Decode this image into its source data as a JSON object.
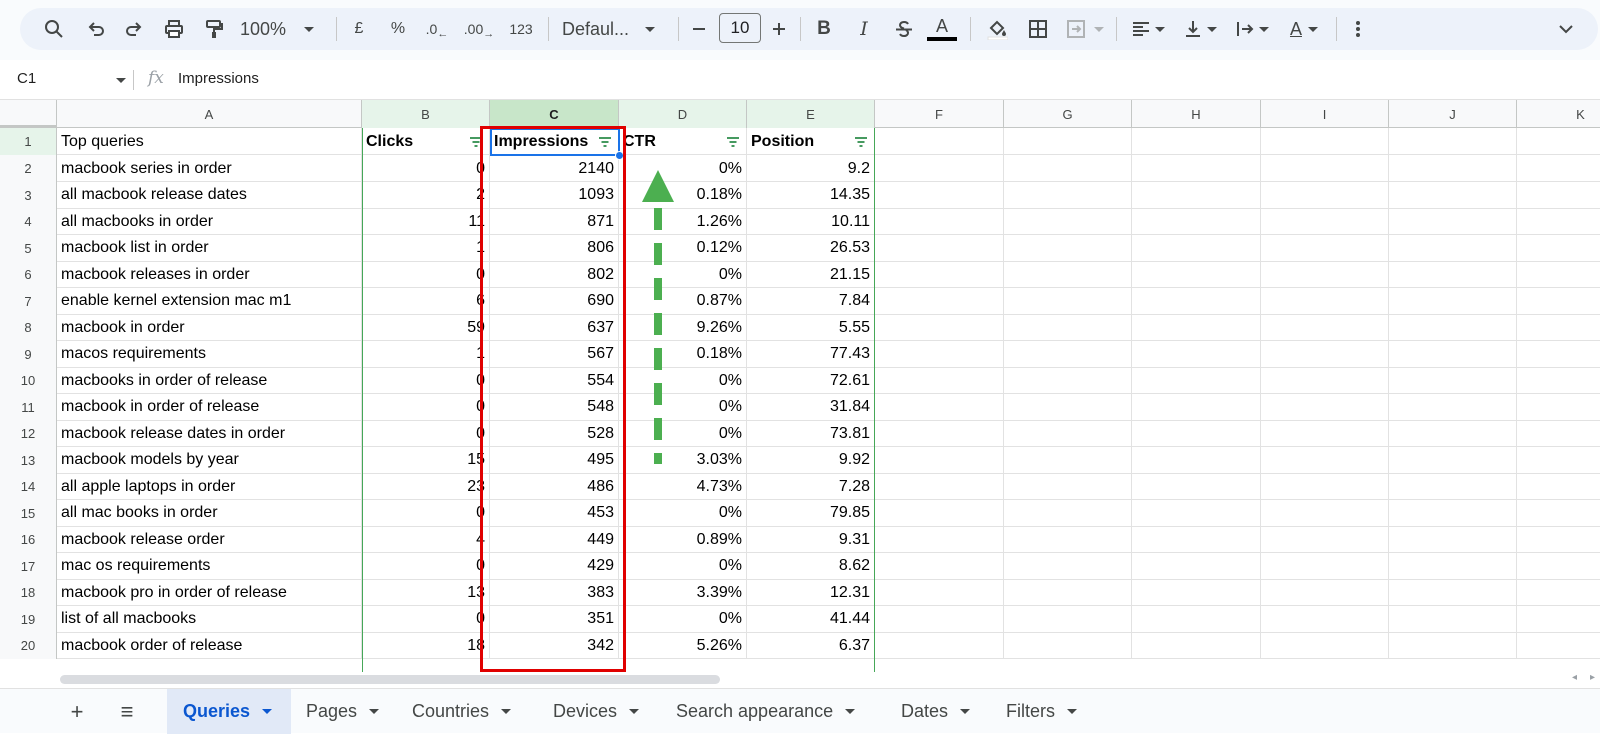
{
  "toolbar": {
    "zoom": "100%",
    "currency": "£",
    "percent": "%",
    "decrease_decimal": ".0",
    "increase_decimal": ".00",
    "number_format": "123",
    "font_name": "Defaul...",
    "font_size": "10",
    "bold": "B",
    "italic": "I",
    "text_color_letter": "A",
    "text_rotate_letter": "A",
    "icons": [
      "search-icon",
      "undo-icon",
      "redo-icon",
      "print-icon",
      "paint-format-icon",
      "minus-icon",
      "plus-icon",
      "strikethrough-icon",
      "fill-color-icon",
      "borders-icon",
      "merge-icon",
      "align-icon",
      "valign-icon",
      "wrap-icon",
      "more-icon",
      "collapse-icon"
    ]
  },
  "formula_bar": {
    "cell_ref": "C1",
    "fx": "fx",
    "content": "Impressions"
  },
  "columns": [
    "A",
    "B",
    "C",
    "D",
    "E",
    "F",
    "G",
    "H",
    "I",
    "J",
    "K"
  ],
  "header_row": {
    "number": "1",
    "query": "Top queries",
    "clicks": "Clicks",
    "impressions": "Impressions",
    "ctr": "CTR",
    "position": "Position"
  },
  "rows": [
    {
      "n": "2",
      "query": "macbook series in order",
      "clicks": "0",
      "impressions": "2140",
      "ctr": "0%",
      "position": "9.2"
    },
    {
      "n": "3",
      "query": "all macbook release dates",
      "clicks": "2",
      "impressions": "1093",
      "ctr": "0.18%",
      "position": "14.35"
    },
    {
      "n": "4",
      "query": "all macbooks in order",
      "clicks": "11",
      "impressions": "871",
      "ctr": "1.26%",
      "position": "10.11"
    },
    {
      "n": "5",
      "query": "macbook list in order",
      "clicks": "1",
      "impressions": "806",
      "ctr": "0.12%",
      "position": "26.53"
    },
    {
      "n": "6",
      "query": "macbook releases in order",
      "clicks": "0",
      "impressions": "802",
      "ctr": "0%",
      "position": "21.15"
    },
    {
      "n": "7",
      "query": "enable kernel extension mac m1",
      "clicks": "6",
      "impressions": "690",
      "ctr": "0.87%",
      "position": "7.84"
    },
    {
      "n": "8",
      "query": "macbook in order",
      "clicks": "59",
      "impressions": "637",
      "ctr": "9.26%",
      "position": "5.55"
    },
    {
      "n": "9",
      "query": "macos requirements",
      "clicks": "1",
      "impressions": "567",
      "ctr": "0.18%",
      "position": "77.43"
    },
    {
      "n": "10",
      "query": "macbooks in order of release",
      "clicks": "0",
      "impressions": "554",
      "ctr": "0%",
      "position": "72.61"
    },
    {
      "n": "11",
      "query": "macbook in order of release",
      "clicks": "0",
      "impressions": "548",
      "ctr": "0%",
      "position": "31.84"
    },
    {
      "n": "12",
      "query": "macbook release dates in order",
      "clicks": "0",
      "impressions": "528",
      "ctr": "0%",
      "position": "73.81"
    },
    {
      "n": "13",
      "query": "macbook models by year",
      "clicks": "15",
      "impressions": "495",
      "ctr": "3.03%",
      "position": "9.92"
    },
    {
      "n": "14",
      "query": "all apple laptops in order",
      "clicks": "23",
      "impressions": "486",
      "ctr": "4.73%",
      "position": "7.28"
    },
    {
      "n": "15",
      "query": "all mac books in order",
      "clicks": "0",
      "impressions": "453",
      "ctr": "0%",
      "position": "79.85"
    },
    {
      "n": "16",
      "query": "macbook release order",
      "clicks": "4",
      "impressions": "449",
      "ctr": "0.89%",
      "position": "9.31"
    },
    {
      "n": "17",
      "query": "mac os requirements",
      "clicks": "0",
      "impressions": "429",
      "ctr": "0%",
      "position": "8.62"
    },
    {
      "n": "18",
      "query": "macbook pro in order of release",
      "clicks": "13",
      "impressions": "383",
      "ctr": "3.39%",
      "position": "12.31"
    },
    {
      "n": "19",
      "query": "list of all macbooks",
      "clicks": "0",
      "impressions": "351",
      "ctr": "0%",
      "position": "41.44"
    },
    {
      "n": "20",
      "query": "macbook order of release",
      "clicks": "18",
      "impressions": "342",
      "ctr": "5.26%",
      "position": "6.37"
    }
  ],
  "sheet_tabs": {
    "add": "+",
    "all_sheets": "≡",
    "tabs": [
      "Queries",
      "Pages",
      "Countries",
      "Devices",
      "Search appearance",
      "Dates",
      "Filters"
    ],
    "active": "Queries"
  },
  "colors": {
    "highlight_box": "#e00000",
    "arrow": "#4caf50",
    "selection": "#1a73e8",
    "filter_header": "#e6f4ea"
  }
}
